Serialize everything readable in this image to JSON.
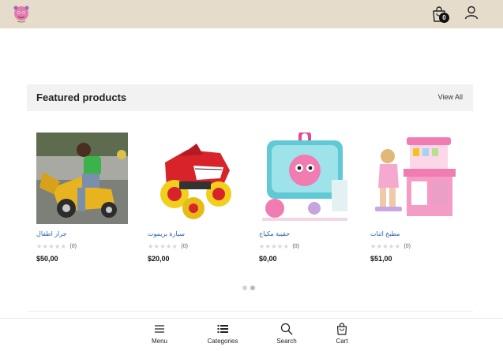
{
  "header": {
    "logo_icon": "pink-creature-logo",
    "cart_count": "0",
    "cart_icon": "shopping-bag-icon",
    "account_icon": "user-icon",
    "background": "#e6dccb"
  },
  "featured": {
    "title": "Featured products",
    "view_all": "View All"
  },
  "products": [
    {
      "name": "جرار اطفال",
      "rating_count": "(0)",
      "price": "$50,00",
      "image": "child-on-toy-tractor"
    },
    {
      "name": "سيارة بريموت",
      "rating_count": "(0)",
      "price": "$20,00",
      "image": "red-monster-truck-toy"
    },
    {
      "name": "حقيبة مكياج",
      "rating_count": "(0)",
      "price": "$0,00",
      "image": "pink-toy-in-carry-case"
    },
    {
      "name": "مطبخ اثنات",
      "rating_count": "(0)",
      "price": "$51,00",
      "image": "girl-at-pink-toy-kitchen"
    }
  ],
  "carousel": {
    "pages": 2,
    "active": 2
  },
  "bottom_nav": [
    {
      "label": "Menu",
      "icon": "hamburger-menu-icon"
    },
    {
      "label": "Categories",
      "icon": "list-icon"
    },
    {
      "label": "Search",
      "icon": "search-icon"
    },
    {
      "label": "Cart",
      "icon": "shopping-bag-icon"
    }
  ],
  "colors": {
    "link": "#2a5ea8",
    "star_empty": "#d4d4d4",
    "header_bg": "#e6dccb"
  }
}
